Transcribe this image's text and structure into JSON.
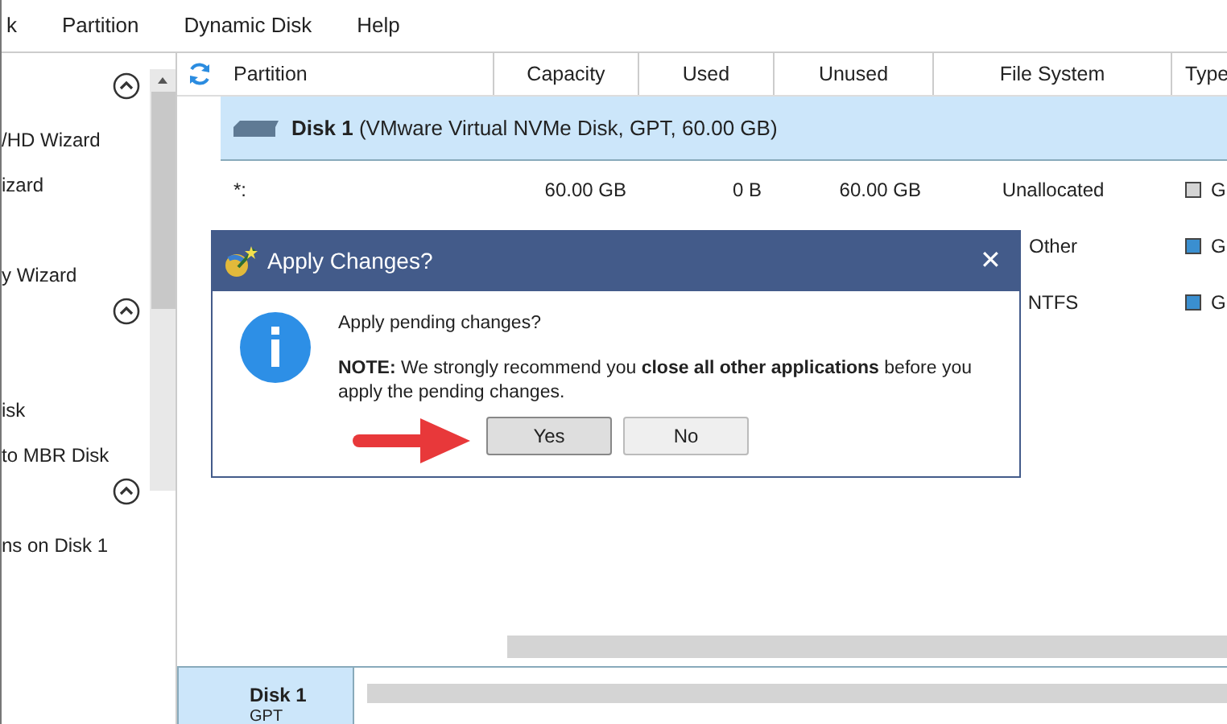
{
  "menu_bar": [
    "k",
    "Partition",
    "Dynamic Disk",
    "Help"
  ],
  "sidebar": {
    "entries": [
      {
        "kind": "collapse"
      },
      {
        "kind": "item",
        "label": "/HD Wizard"
      },
      {
        "kind": "item",
        "label": "izard"
      },
      {
        "kind": "spacer"
      },
      {
        "kind": "item",
        "label": "y Wizard"
      },
      {
        "kind": "collapse"
      },
      {
        "kind": "spacer"
      },
      {
        "kind": "item",
        "label": "isk"
      },
      {
        "kind": "item",
        "label": "to MBR Disk"
      },
      {
        "kind": "collapse"
      },
      {
        "kind": "item",
        "label": "ns on Disk 1"
      }
    ]
  },
  "table": {
    "columns": [
      "Partition",
      "Capacity",
      "Used",
      "Unused",
      "File System",
      "Type"
    ],
    "disk_row": {
      "name": "Disk 1",
      "detail": "(VMware Virtual NVMe Disk, GPT, 60.00 GB)",
      "selected": true
    },
    "rows": [
      {
        "partition": "*:",
        "capacity": "60.00 GB",
        "used": "0 B",
        "unused": "60.00 GB",
        "file_system": "Unallocated",
        "type": "G",
        "color": "#d4d4d4"
      },
      {
        "partition": "",
        "capacity": "",
        "used": "",
        "unused": "",
        "file_system": "Other",
        "type": "G",
        "color": "#3a8fd0"
      },
      {
        "partition": "",
        "capacity": "",
        "used": "",
        "unused": "",
        "file_system": "NTFS",
        "type": "G",
        "color": "#3a8fd0"
      }
    ]
  },
  "disk_map": {
    "name": "Disk 1",
    "style": "GPT"
  },
  "dialog": {
    "title": "Apply Changes?",
    "close": "✕",
    "question": "Apply pending changes?",
    "note": "**NOTE:** We strongly recommend you **close all other applications** before you apply the pending changes.",
    "buttons": [
      {
        "label": "Yes",
        "selected": true
      },
      {
        "label": "No",
        "selected": false
      }
    ]
  }
}
